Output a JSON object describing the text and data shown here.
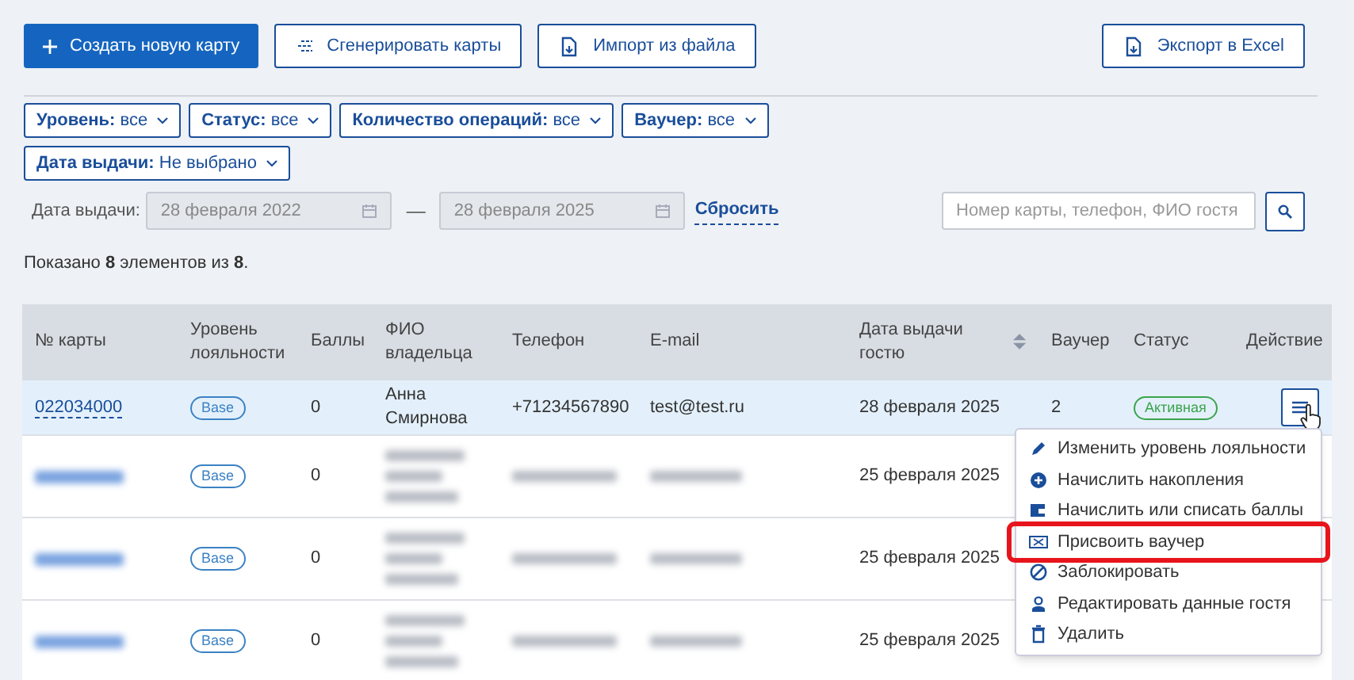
{
  "toolbar": {
    "primary": "Создать новую карту",
    "buttons": [
      {
        "kind": "generate",
        "label": "Сгенерировать карты"
      },
      {
        "kind": "import",
        "label": "Импорт из файла"
      }
    ],
    "export": "Экспорт в Excel"
  },
  "filters": [
    {
      "label": "Уровень:",
      "value": "все"
    },
    {
      "label": "Статус:",
      "value": "все"
    },
    {
      "label": "Количество операций:",
      "value": "все"
    },
    {
      "label": "Ваучер:",
      "value": "все"
    },
    {
      "label": "Дата выдачи:",
      "value": "Не выбрано"
    }
  ],
  "date_range": {
    "label": "Дата выдачи:",
    "from": "28 февраля 2022",
    "to": "28 февраля 2025",
    "separator": "—",
    "reset": "Сбросить"
  },
  "search": {
    "placeholder": "Номер карты, телефон, ФИО гостя"
  },
  "summary": "Показано **8** элементов из **8**.",
  "table": {
    "columns": [
      "№ карты",
      "Уровень лояльности",
      "Баллы",
      "ФИО владельца",
      "Телефон",
      "E-mail",
      "Дата выдачи гостю",
      "Ваучер",
      "Статус",
      "Действие"
    ],
    "rows": [
      {
        "selected": true,
        "redacted": false,
        "card": "022034000",
        "level": "Base",
        "points": "0",
        "name": "Анна Смирнова",
        "phone": "+71234567890",
        "email": "test@test.ru",
        "issued": "28 февраля 2025",
        "voucher": "2",
        "status": "Активная"
      },
      {
        "selected": false,
        "redacted": true,
        "level": "Base",
        "points": "0",
        "issued": "25 февраля 2025"
      },
      {
        "selected": false,
        "redacted": true,
        "level": "Base",
        "points": "0",
        "issued": "25 февраля 2025"
      },
      {
        "selected": false,
        "redacted": true,
        "level": "Base",
        "points": "0",
        "issued": "25 февраля 2025"
      }
    ]
  },
  "action_menu": [
    {
      "kind": "edit",
      "label": "Изменить уровень лояльности",
      "highlighted": false
    },
    {
      "kind": "add",
      "label": "Начислить накопления",
      "highlighted": false
    },
    {
      "kind": "wallet",
      "label": "Начислить или списать баллы",
      "highlighted": false
    },
    {
      "kind": "voucher",
      "label": "Присвоить ваучер",
      "highlighted": true
    },
    {
      "kind": "block",
      "label": "Заблокировать",
      "highlighted": false
    },
    {
      "kind": "user",
      "label": "Редактировать данные гостя",
      "highlighted": false
    },
    {
      "kind": "delete",
      "label": "Удалить",
      "highlighted": false
    }
  ]
}
